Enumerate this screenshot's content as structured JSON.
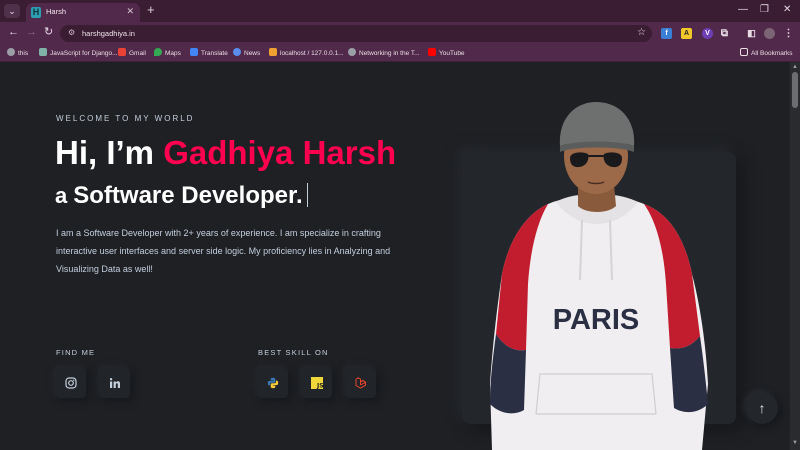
{
  "browser": {
    "tab_title": "Harsh",
    "tab_favicon": "H",
    "url": "harshgadhiya.in",
    "bookmarks": [
      {
        "label": "this",
        "icon": "globe-icon"
      },
      {
        "label": "JavaScript for Django...",
        "icon": "document-icon"
      },
      {
        "label": "Gmail",
        "icon": "gmail-icon"
      },
      {
        "label": "Maps",
        "icon": "maps-icon"
      },
      {
        "label": "Translate",
        "icon": "translate-icon"
      },
      {
        "label": "News",
        "icon": "news-icon"
      },
      {
        "label": "localhost / 127.0.0.1...",
        "icon": "phpmyadmin-icon"
      },
      {
        "label": "Networking in the T...",
        "icon": "globe-icon"
      },
      {
        "label": "YouTube",
        "icon": "youtube-icon"
      }
    ],
    "all_bookmarks": "All Bookmarks"
  },
  "hero": {
    "welcome": "WELCOME TO MY WORLD",
    "greeting": "Hi, I’m ",
    "name": "Gadhiya Harsh",
    "role_prefix": "a",
    "role": "Software Developer.",
    "bio": "I am a Software Developer with 2+ years of experience. I am specialize in crafting interactive user interfaces and server side logic. My proficiency lies in Analyzing and Visualizing Data as well!"
  },
  "find_me": {
    "label": "FIND ME",
    "icons": [
      "instagram-icon",
      "linkedin-icon"
    ]
  },
  "skills": {
    "label": "BEST SKILL ON",
    "icons": [
      "python-icon",
      "javascript-icon",
      "laravel-icon"
    ]
  },
  "colors": {
    "accent": "#ff014f",
    "background": "#1e2024",
    "text": "#c4cfde",
    "chrome": "#51294a"
  },
  "photo": {
    "shirt_text": "PARIS"
  }
}
